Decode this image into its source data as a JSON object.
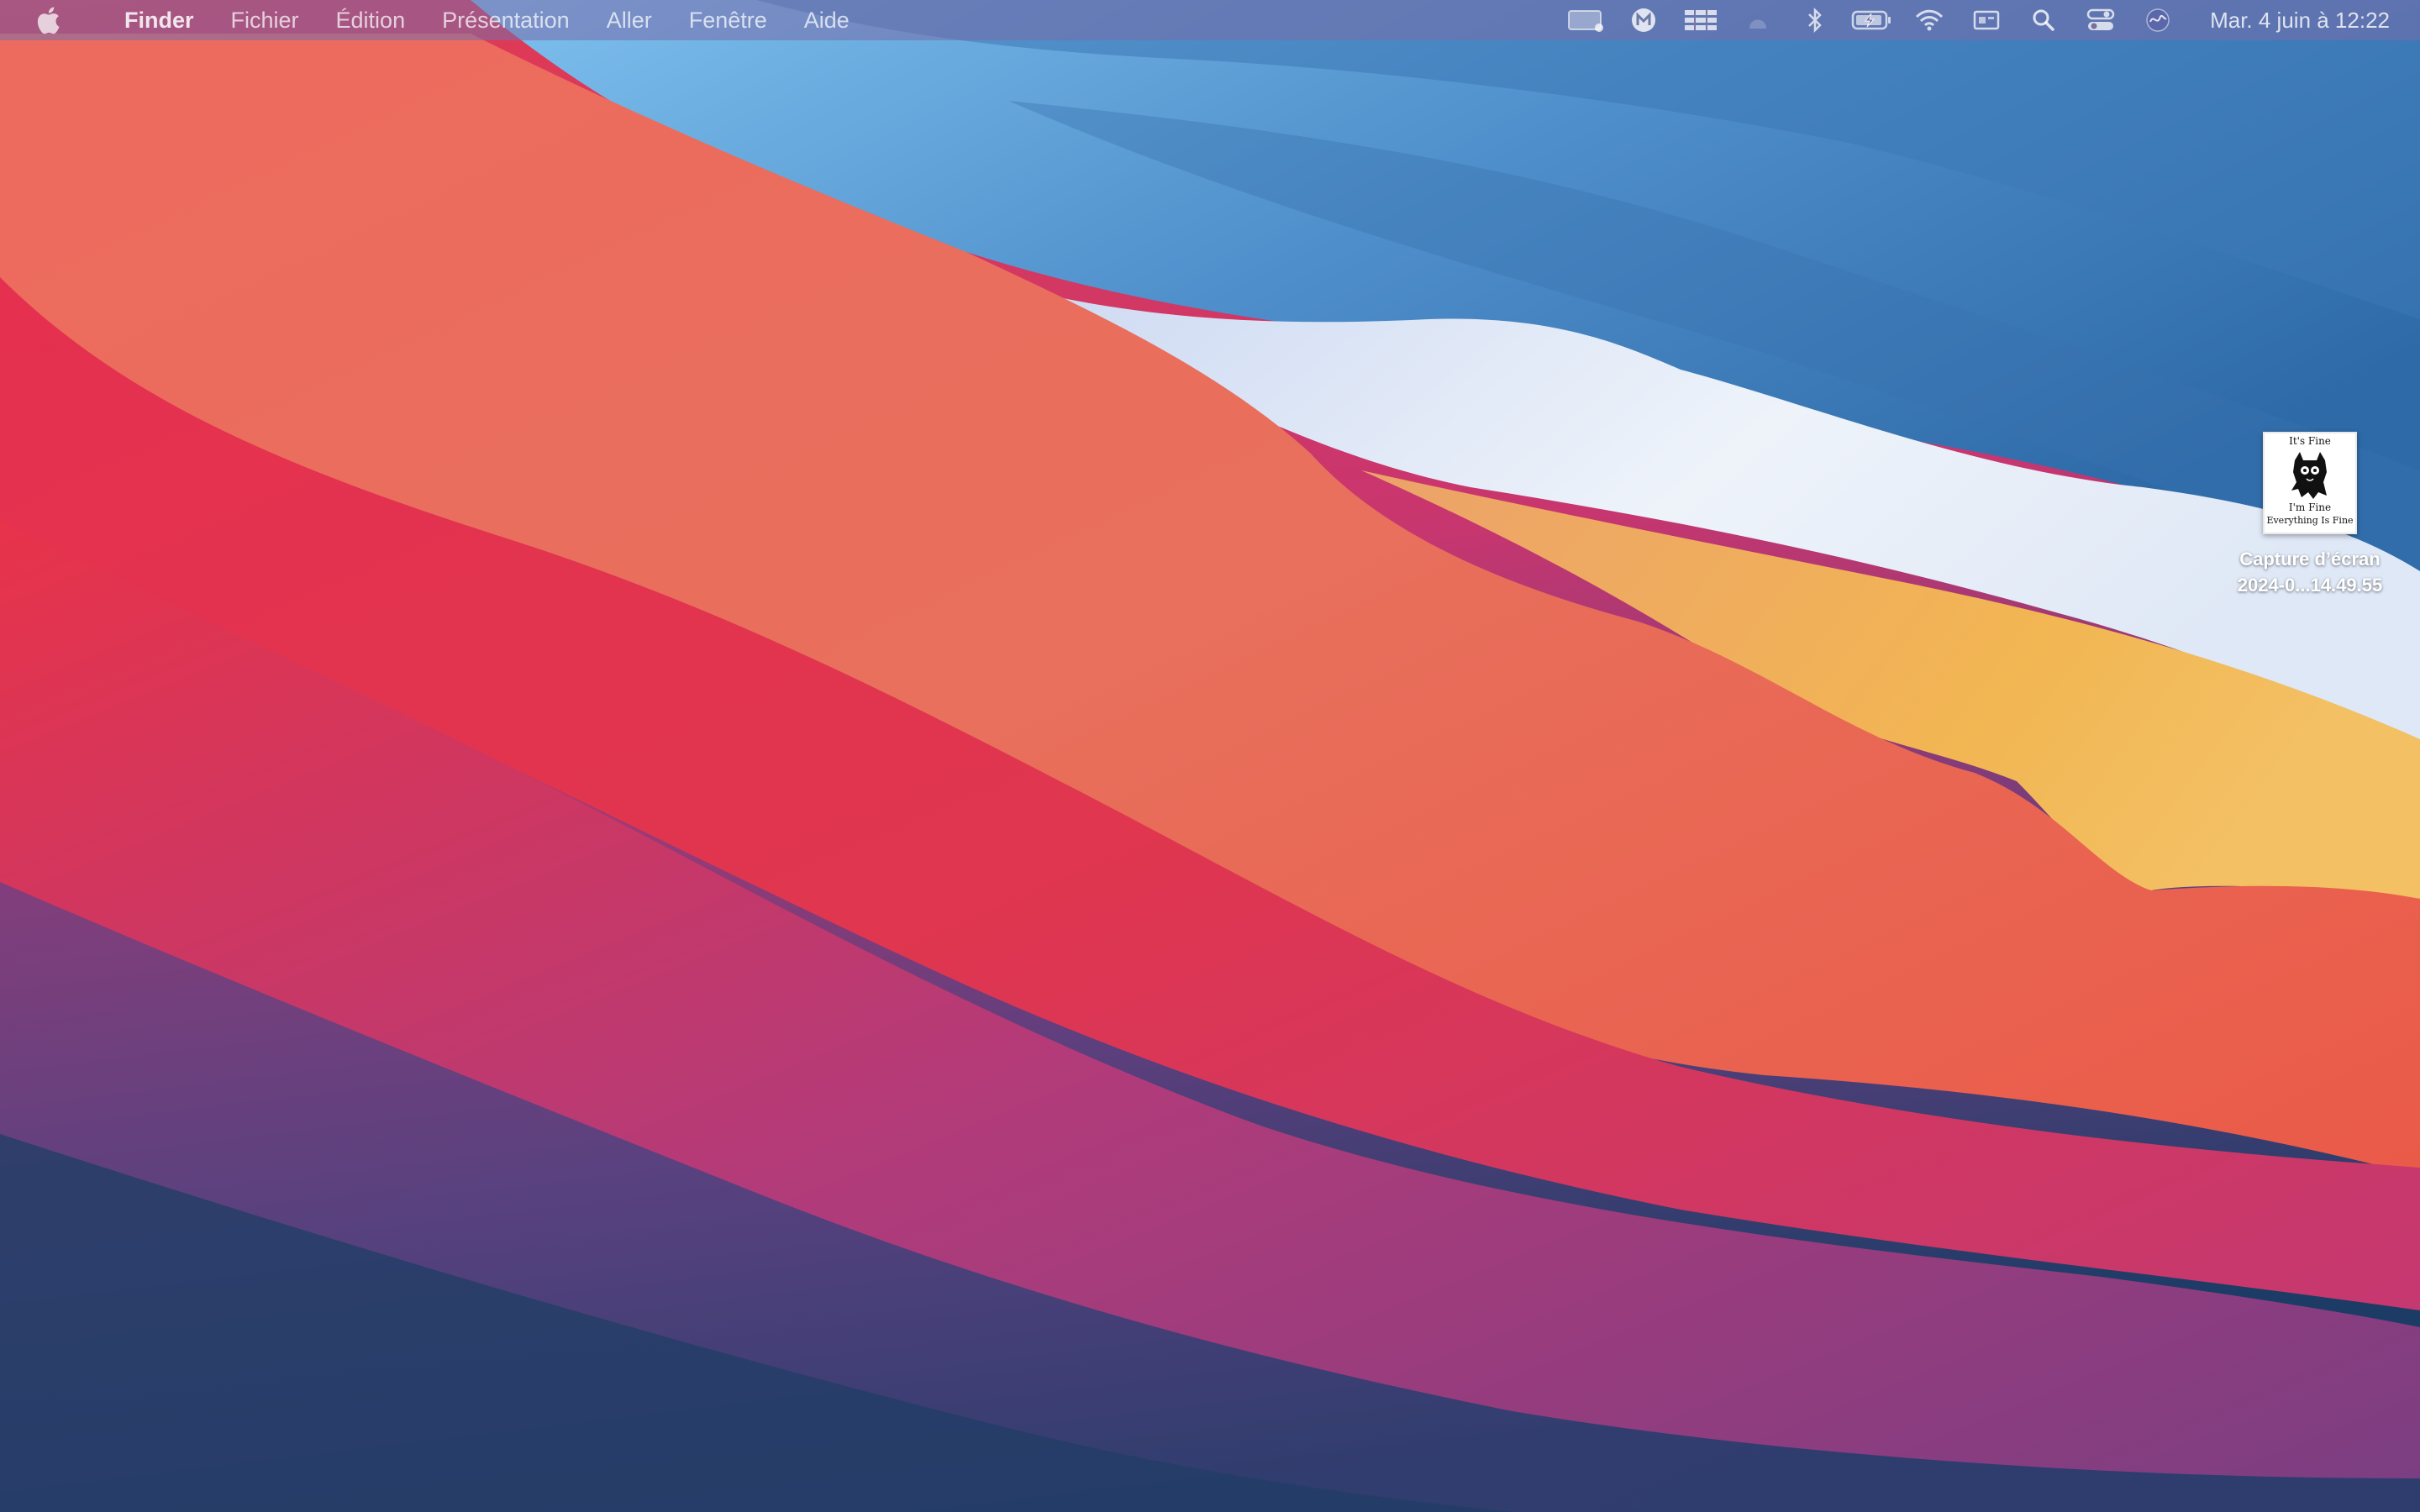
{
  "menubar": {
    "apple_icon": "apple-logo",
    "app_name": "Finder",
    "menus": [
      "Fichier",
      "Édition",
      "Présentation",
      "Aller",
      "Fenêtre",
      "Aide"
    ],
    "status_icons": [
      "screen-recording-icon",
      "malwarebytes-icon",
      "keyboard-brightness-icon",
      "dimmed-app-icon",
      "bluetooth-icon",
      "battery-charging-icon",
      "wifi-icon",
      "display-mirroring-icon",
      "spotlight-search-icon",
      "control-center-icon",
      "siri-icon"
    ],
    "clock": "Mar. 4 juin à  12:22"
  },
  "desktop": {
    "file": {
      "label_line1": "Capture d’écran",
      "label_line2": "2024-0...14.49.55",
      "thumbnail_text": [
        "It's Fine",
        "I'm Fine",
        "Everything Is Fine"
      ]
    }
  },
  "colors": {
    "menubar_bg": "#786eaa",
    "wallpaper_red": "#e8334a",
    "wallpaper_orange": "#ec6f5a",
    "wallpaper_blue": "#3f7fc0",
    "wallpaper_yellow": "#f2b653",
    "wallpaper_purple": "#6a3f7e"
  }
}
